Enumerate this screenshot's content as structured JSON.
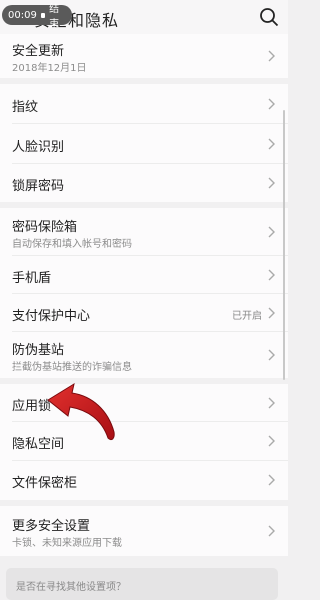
{
  "header": {
    "title": "安全和隐私",
    "recording": {
      "time": "00:09",
      "end_label": "结束"
    }
  },
  "groups": [
    {
      "items": [
        {
          "label": "安全更新",
          "sub": "2018年12月1日"
        }
      ]
    },
    {
      "items": [
        {
          "label": "指纹"
        },
        {
          "label": "人脸识别"
        },
        {
          "label": "锁屏密码"
        }
      ]
    },
    {
      "items": [
        {
          "label": "密码保险箱",
          "sub": "自动保存和填入帐号和密码"
        },
        {
          "label": "手机盾"
        },
        {
          "label": "支付保护中心",
          "value": "已开启"
        },
        {
          "label": "防伪基站",
          "sub": "拦截伪基站推送的诈骗信息"
        }
      ]
    },
    {
      "items": [
        {
          "label": "应用锁"
        },
        {
          "label": "隐私空间"
        },
        {
          "label": "文件保密柜"
        }
      ]
    },
    {
      "items": [
        {
          "label": "更多安全设置",
          "sub": "卡锁、未知来源应用下载"
        }
      ]
    }
  ],
  "hint": {
    "text": "是否在寻找其他设置项？"
  },
  "colors": {
    "background": "#f1f0f1",
    "card": "#fcfbfc",
    "annotation_arrow": "#c0161b"
  }
}
